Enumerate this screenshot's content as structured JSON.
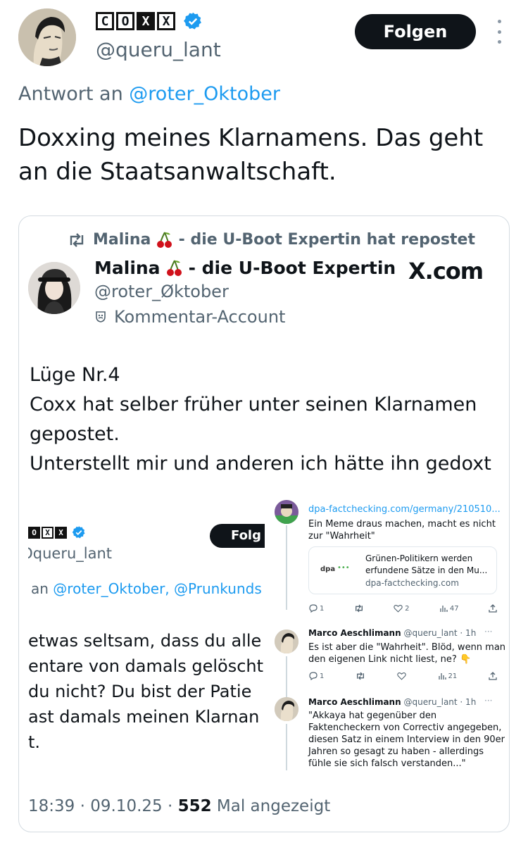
{
  "header": {
    "logo_letters": [
      "C",
      "O",
      "X",
      "X"
    ],
    "handle": "@queru_lant",
    "follow_label": "Folgen"
  },
  "reply": {
    "prefix": "Antwort an",
    "mention": "@roter_Oktober"
  },
  "tweet": {
    "text": "Doxxing meines Klarnamens. Das geht an die Staatsanwaltschaft."
  },
  "quote": {
    "repost_user": "Malina",
    "repost_suffix": "- die U-Boot Expertin hat repostet",
    "name": "Malina",
    "name_suffix": "- die U-Boot Expertin",
    "brand": "X.com",
    "handle": "@roter_Øktober",
    "badge": "Kommentar-Account",
    "lines": [
      "Lüge Nr.4",
      "Coxx hat selber früher unter seinen Klarnamen",
      "gepostet.",
      "Unterstellt mir und anderen ich hätte ihn gedoxt"
    ]
  },
  "embed_left": {
    "logo_letters": [
      "O",
      "X",
      "X"
    ],
    "handle": "Ɔqueru_lant",
    "follow_label": "Folg",
    "reply_prefix": "an",
    "reply_mentions": "@roter_Oktober, @Prunkunds",
    "lines": [
      "etwas seltsam, dass du alle",
      "entare von damals gelöscht",
      " du nicht? Du bist der Patie",
      "ast damals meinen Klarnan",
      "t."
    ]
  },
  "embed_right": {
    "link": "dpa-factchecking.com/germany/210510...",
    "text1": [
      "Ein Meme draus machen, macht es nicht",
      "zur \"Wahrheit\""
    ],
    "card": {
      "logo": "dpa",
      "dots": "•••",
      "title": [
        "Grünen-Politikern werden",
        "erfundene Sätze in den Mu..."
      ],
      "domain": "dpa-factchecking.com"
    },
    "actions1": {
      "replies": "1",
      "likes": "2",
      "views": "47"
    },
    "reply1": {
      "author": "Marco Aeschlimann",
      "handle_time": "@queru_lant · 1h",
      "more": "···",
      "lines": [
        "Es ist aber die \"Wahrheit\". Blöd, wenn man",
        "den eigenen Link nicht liest, ne? 👇"
      ]
    },
    "actions2": {
      "replies": "1",
      "views": "21"
    },
    "reply2": {
      "author": "Marco Aeschlimann",
      "handle_time": "@queru_lant · 1h",
      "more": "···",
      "lines": [
        "\"Akkaya hat gegenüber den",
        "Faktencheckern von Correctiv angegeben,",
        "diesen Satz in einem Interview in den 90er",
        "Jahren so gesagt zu haben - allerdings",
        "fühle sie sich falsch verstanden...\""
      ]
    }
  },
  "footer": {
    "time": "18:39",
    "date": "09.10.25",
    "views_count": "552",
    "views_label": "Mal angezeigt"
  },
  "colors": {
    "accent": "#1d9bf0",
    "text": "#0f1419",
    "muted": "#536471",
    "button": "#0f1419"
  }
}
